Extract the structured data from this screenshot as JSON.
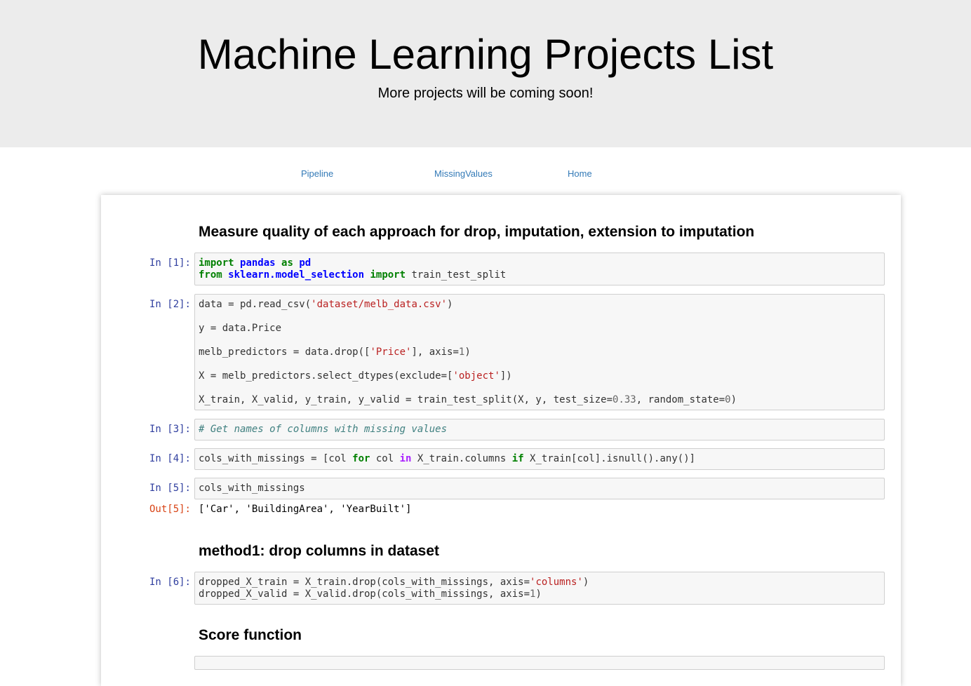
{
  "hero": {
    "title": "Machine Learning Projects List",
    "subtitle": "More projects will be coming soon!"
  },
  "nav": {
    "pipeline": "Pipeline",
    "missing": "MissingValues",
    "home": "Home"
  },
  "notebook": {
    "heading1": "Measure quality of each approach for drop, imputation, extension to imputation",
    "heading2": "method1: drop columns in dataset",
    "heading3": "Score function",
    "cells": [
      {
        "prompt": "In [1]:"
      },
      {
        "prompt": "In [2]:"
      },
      {
        "prompt": "In [3]:"
      },
      {
        "prompt": "In [4]:"
      },
      {
        "prompt": "In [5]:",
        "out_prompt": "Out[5]:",
        "output": "['Car', 'BuildingArea', 'YearBuilt']"
      },
      {
        "prompt": "In [6]:"
      }
    ],
    "code": {
      "c1_l1": [
        "import",
        "pandas",
        "as",
        "pd"
      ],
      "c1_l2": [
        "from",
        "sklearn.model_selection",
        "import",
        "train_test_split"
      ],
      "c2_l1": [
        "data = pd.read_csv(",
        "'dataset/melb_data.csv'",
        ")"
      ],
      "c2_l2": "y = data.Price",
      "c2_l3": [
        "melb_predictors = data.drop([",
        "'Price'",
        "], axis=",
        "1",
        ")"
      ],
      "c2_l4": [
        "X = melb_predictors.select_dtypes(exclude=[",
        "'object'",
        "])"
      ],
      "c2_l5": [
        "X_train, X_valid, y_train, y_valid = train_test_split(X, y, test_size=",
        "0.33",
        ", random_state=",
        "0",
        ")"
      ],
      "c3": "# Get names of columns with missing values",
      "c4": [
        "cols_with_missings = [col ",
        "for",
        " col ",
        "in",
        " X_train.columns ",
        "if",
        " X_train[col].isnull().any()]"
      ],
      "c5": "cols_with_missings",
      "c6_l1": [
        "dropped_X_train = X_train.drop(cols_with_missings, axis=",
        "'columns'",
        ")"
      ],
      "c6_l2": [
        "dropped_X_valid = X_valid.drop(cols_with_missings, axis=",
        "1",
        ")"
      ]
    }
  }
}
